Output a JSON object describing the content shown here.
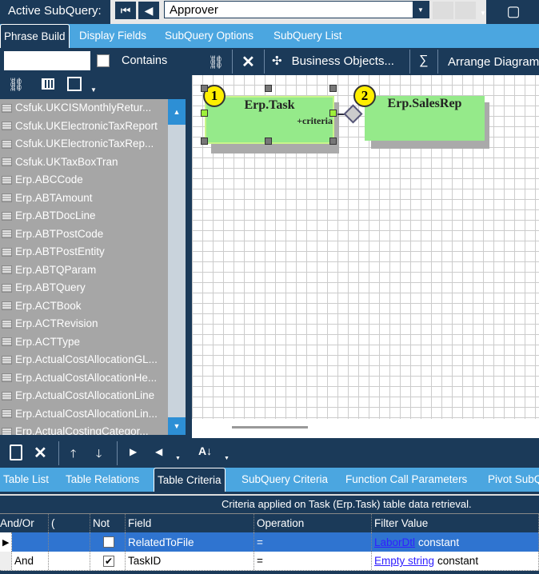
{
  "header": {
    "active_label": "Active SubQuery:",
    "subquery_value": "Approver"
  },
  "main_tabs": [
    "Phrase Build",
    "Display Fields",
    "SubQuery Options",
    "SubQuery List"
  ],
  "left": {
    "search_value": "",
    "contains_label": "Contains",
    "items": [
      "Csfuk.UKCISMonthlyRetur...",
      "Csfuk.UKElectronicTaxReport",
      "Csfuk.UKElectronicTaxRep...",
      "Csfuk.UKTaxBoxTran",
      "Erp.ABCCode",
      "Erp.ABTAmount",
      "Erp.ABTDocLine",
      "Erp.ABTPostCode",
      "Erp.ABTPostEntity",
      "Erp.ABTQParam",
      "Erp.ABTQuery",
      "Erp.ACTBook",
      "Erp.ACTRevision",
      "Erp.ACTType",
      "Erp.ActualCostAllocationGL...",
      "Erp.ActualCostAllocationHe...",
      "Erp.ActualCostAllocationLine",
      "Erp.ActualCostAllocationLin...",
      "Erp.ActualCostingCategor..."
    ]
  },
  "diagram_toolbar": {
    "business_objects": "Business Objects...",
    "sum": "∑",
    "arrange": "Arrange Diagram"
  },
  "diagram": {
    "tables": [
      {
        "num": "1",
        "name": "Erp.Task",
        "note": "+criteria"
      },
      {
        "num": "2",
        "name": "Erp.SalesRep"
      }
    ]
  },
  "bottom_tabs": [
    "Table List",
    "Table Relations",
    "Table Criteria",
    "SubQuery Criteria",
    "Function Call Parameters",
    "Pivot SubQ"
  ],
  "criteria": {
    "info": "Criteria applied on Task (Erp.Task)  table data retrieval.",
    "columns": [
      "And/Or",
      "(",
      "Not",
      "Field",
      "Operation",
      "Filter Value"
    ],
    "rows": [
      {
        "andor": "",
        "paren": "",
        "not": false,
        "field": "RelatedToFile",
        "op": "=",
        "value_link": "LaborDtl",
        "value_type": "constant"
      },
      {
        "andor": "And",
        "paren": "",
        "not": true,
        "field": "TaskID",
        "op": "=",
        "value_link": "Empty string",
        "value_type": "constant"
      }
    ]
  }
}
